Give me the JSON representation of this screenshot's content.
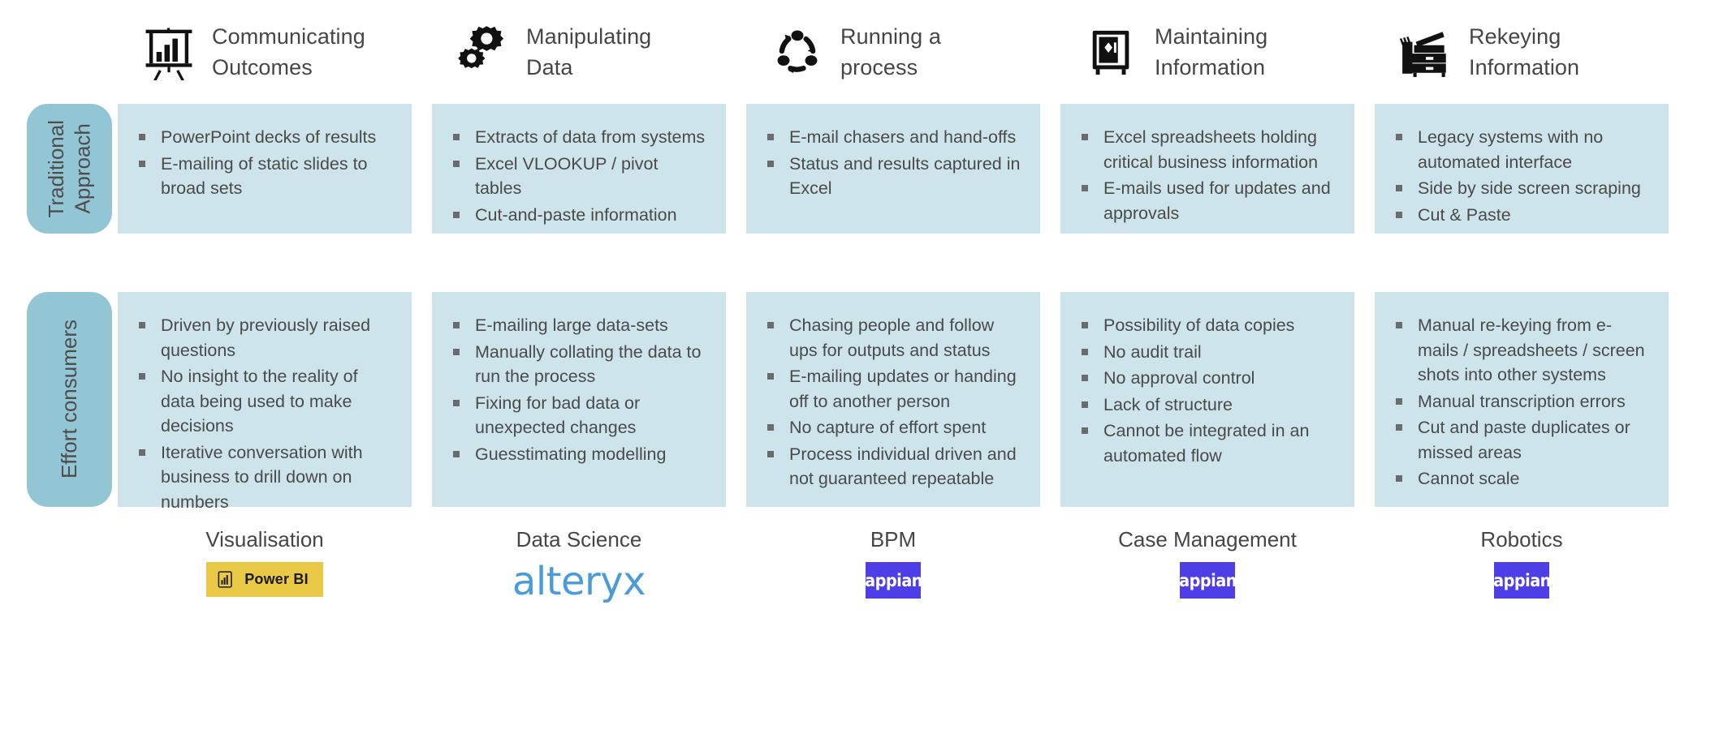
{
  "columns": [
    {
      "icon": "presentation-chart-icon",
      "title": "Communicating\nOutcomes",
      "traditional": [
        "PowerPoint decks of results",
        "E-mailing of static slides to broad sets"
      ],
      "effort": [
        "Driven by previously raised questions",
        "No insight to the reality of data being used to make decisions",
        "Iterative conversation with business to drill down on numbers"
      ],
      "footer_title": "Visualisation",
      "logo": {
        "type": "powerbi",
        "text": "Power BI",
        "bg": "#e8c845",
        "fg": "#1b1b1b"
      }
    },
    {
      "icon": "gears-icon",
      "title": "Manipulating\nData",
      "traditional": [
        "Extracts of data from systems",
        "Excel VLOOKUP / pivot tables",
        "Cut-and-paste information"
      ],
      "effort": [
        "E-mailing large data-sets",
        "Manually collating the data to run the process",
        "Fixing for bad data or unexpected changes",
        "Guesstimating modelling"
      ],
      "footer_title": "Data Science",
      "logo": {
        "type": "alteryx",
        "text": "alteryx",
        "bg": "#ffffff",
        "fg": "#4a9bd8"
      }
    },
    {
      "icon": "process-cycle-icon",
      "title": "Running a\nprocess",
      "traditional": [
        "E-mail chasers and hand-offs",
        "Status and results captured in Excel"
      ],
      "effort": [
        "Chasing people and follow ups for outputs and status",
        "E-mailing updates or handing off to another person",
        "No capture of effort spent",
        "Process individual driven and not guaranteed repeatable"
      ],
      "footer_title": "BPM",
      "logo": {
        "type": "appian",
        "text": "appian",
        "bg": "#4d3ee8",
        "fg": "#ffffff"
      }
    },
    {
      "icon": "safe-vault-icon",
      "title": "Maintaining\nInformation",
      "traditional": [
        "Excel spreadsheets holding critical business information",
        "E-mails used for updates and approvals"
      ],
      "effort": [
        "Possibility of data copies",
        "No audit trail",
        "No approval control",
        "Lack of structure",
        "Cannot be integrated in an automated flow"
      ],
      "footer_title": "Case Management",
      "logo": {
        "type": "appian",
        "text": "appian",
        "bg": "#4d3ee8",
        "fg": "#ffffff"
      }
    },
    {
      "icon": "printer-copier-icon",
      "title": "Rekeying\nInformation",
      "traditional": [
        "Legacy systems with no automated interface",
        "Side by side screen scraping",
        "Cut & Paste"
      ],
      "effort": [
        "Manual re-keying from e-mails / spreadsheets / screen shots into other systems",
        "Manual transcription errors",
        "Cut and paste duplicates or missed areas",
        "Cannot scale"
      ],
      "footer_title": "Robotics",
      "logo": {
        "type": "appian",
        "text": "appian",
        "bg": "#4d3ee8",
        "fg": "#ffffff"
      }
    }
  ],
  "rows": [
    {
      "label": "Traditional\nApproach",
      "key": "traditional"
    },
    {
      "label": "Effort consumers",
      "key": "effort"
    }
  ],
  "colors": {
    "row_label_bg": "#93c6d4",
    "cell_bg": "#cde5ea",
    "text": "#4a4a4a",
    "bullet": "#6b6b6b",
    "powerbi_yellow": "#e8c845",
    "alteryx_blue": "#4a9bd8",
    "appian_purple": "#4d3ee8"
  }
}
